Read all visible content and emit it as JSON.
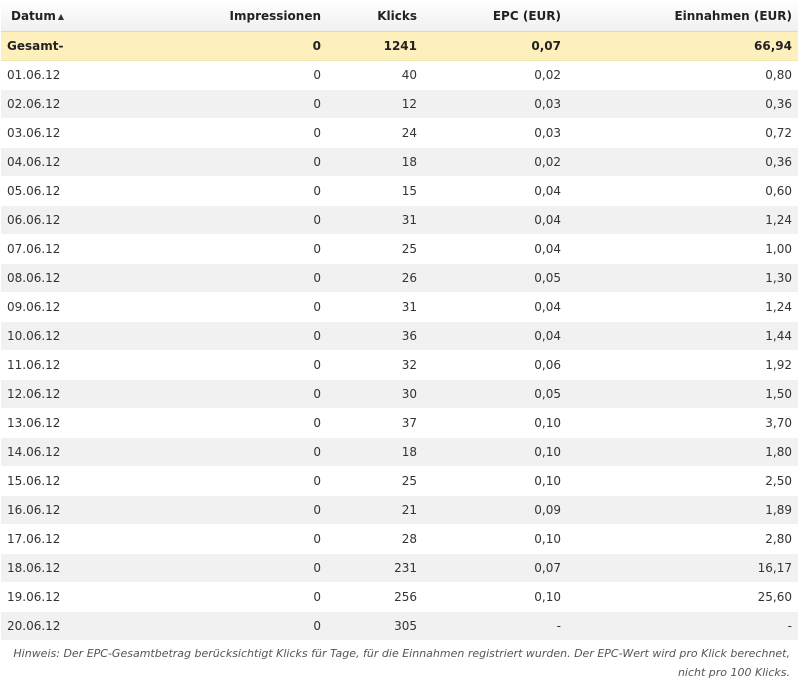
{
  "columns": {
    "datum": "Datum",
    "sort_arrow": "▲",
    "impressionen": "Impressionen",
    "klicks": "Klicks",
    "epc": "EPC (EUR)",
    "einnahmen": "Einnahmen (EUR)"
  },
  "total": {
    "datum": "Gesamt-",
    "impressionen": "0",
    "klicks": "1241",
    "epc": "0,07",
    "einnahmen": "66,94"
  },
  "rows": [
    {
      "datum": "01.06.12",
      "impressionen": "0",
      "klicks": "40",
      "epc": "0,02",
      "einnahmen": "0,80"
    },
    {
      "datum": "02.06.12",
      "impressionen": "0",
      "klicks": "12",
      "epc": "0,03",
      "einnahmen": "0,36"
    },
    {
      "datum": "03.06.12",
      "impressionen": "0",
      "klicks": "24",
      "epc": "0,03",
      "einnahmen": "0,72"
    },
    {
      "datum": "04.06.12",
      "impressionen": "0",
      "klicks": "18",
      "epc": "0,02",
      "einnahmen": "0,36"
    },
    {
      "datum": "05.06.12",
      "impressionen": "0",
      "klicks": "15",
      "epc": "0,04",
      "einnahmen": "0,60"
    },
    {
      "datum": "06.06.12",
      "impressionen": "0",
      "klicks": "31",
      "epc": "0,04",
      "einnahmen": "1,24"
    },
    {
      "datum": "07.06.12",
      "impressionen": "0",
      "klicks": "25",
      "epc": "0,04",
      "einnahmen": "1,00"
    },
    {
      "datum": "08.06.12",
      "impressionen": "0",
      "klicks": "26",
      "epc": "0,05",
      "einnahmen": "1,30"
    },
    {
      "datum": "09.06.12",
      "impressionen": "0",
      "klicks": "31",
      "epc": "0,04",
      "einnahmen": "1,24"
    },
    {
      "datum": "10.06.12",
      "impressionen": "0",
      "klicks": "36",
      "epc": "0,04",
      "einnahmen": "1,44"
    },
    {
      "datum": "11.06.12",
      "impressionen": "0",
      "klicks": "32",
      "epc": "0,06",
      "einnahmen": "1,92"
    },
    {
      "datum": "12.06.12",
      "impressionen": "0",
      "klicks": "30",
      "epc": "0,05",
      "einnahmen": "1,50"
    },
    {
      "datum": "13.06.12",
      "impressionen": "0",
      "klicks": "37",
      "epc": "0,10",
      "einnahmen": "3,70"
    },
    {
      "datum": "14.06.12",
      "impressionen": "0",
      "klicks": "18",
      "epc": "0,10",
      "einnahmen": "1,80"
    },
    {
      "datum": "15.06.12",
      "impressionen": "0",
      "klicks": "25",
      "epc": "0,10",
      "einnahmen": "2,50"
    },
    {
      "datum": "16.06.12",
      "impressionen": "0",
      "klicks": "21",
      "epc": "0,09",
      "einnahmen": "1,89"
    },
    {
      "datum": "17.06.12",
      "impressionen": "0",
      "klicks": "28",
      "epc": "0,10",
      "einnahmen": "2,80"
    },
    {
      "datum": "18.06.12",
      "impressionen": "0",
      "klicks": "231",
      "epc": "0,07",
      "einnahmen": "16,17"
    },
    {
      "datum": "19.06.12",
      "impressionen": "0",
      "klicks": "256",
      "epc": "0,10",
      "einnahmen": "25,60"
    },
    {
      "datum": "20.06.12",
      "impressionen": "0",
      "klicks": "305",
      "epc": "-",
      "einnahmen": "-"
    }
  ],
  "note": {
    "line1": "Hinweis: Der EPC-Gesamtbetrag berücksichtigt Klicks für Tage, für die Einnahmen registriert wurden. Der EPC-Wert wird pro Klick berechnet,",
    "line2": "nicht pro 100 Klicks."
  }
}
